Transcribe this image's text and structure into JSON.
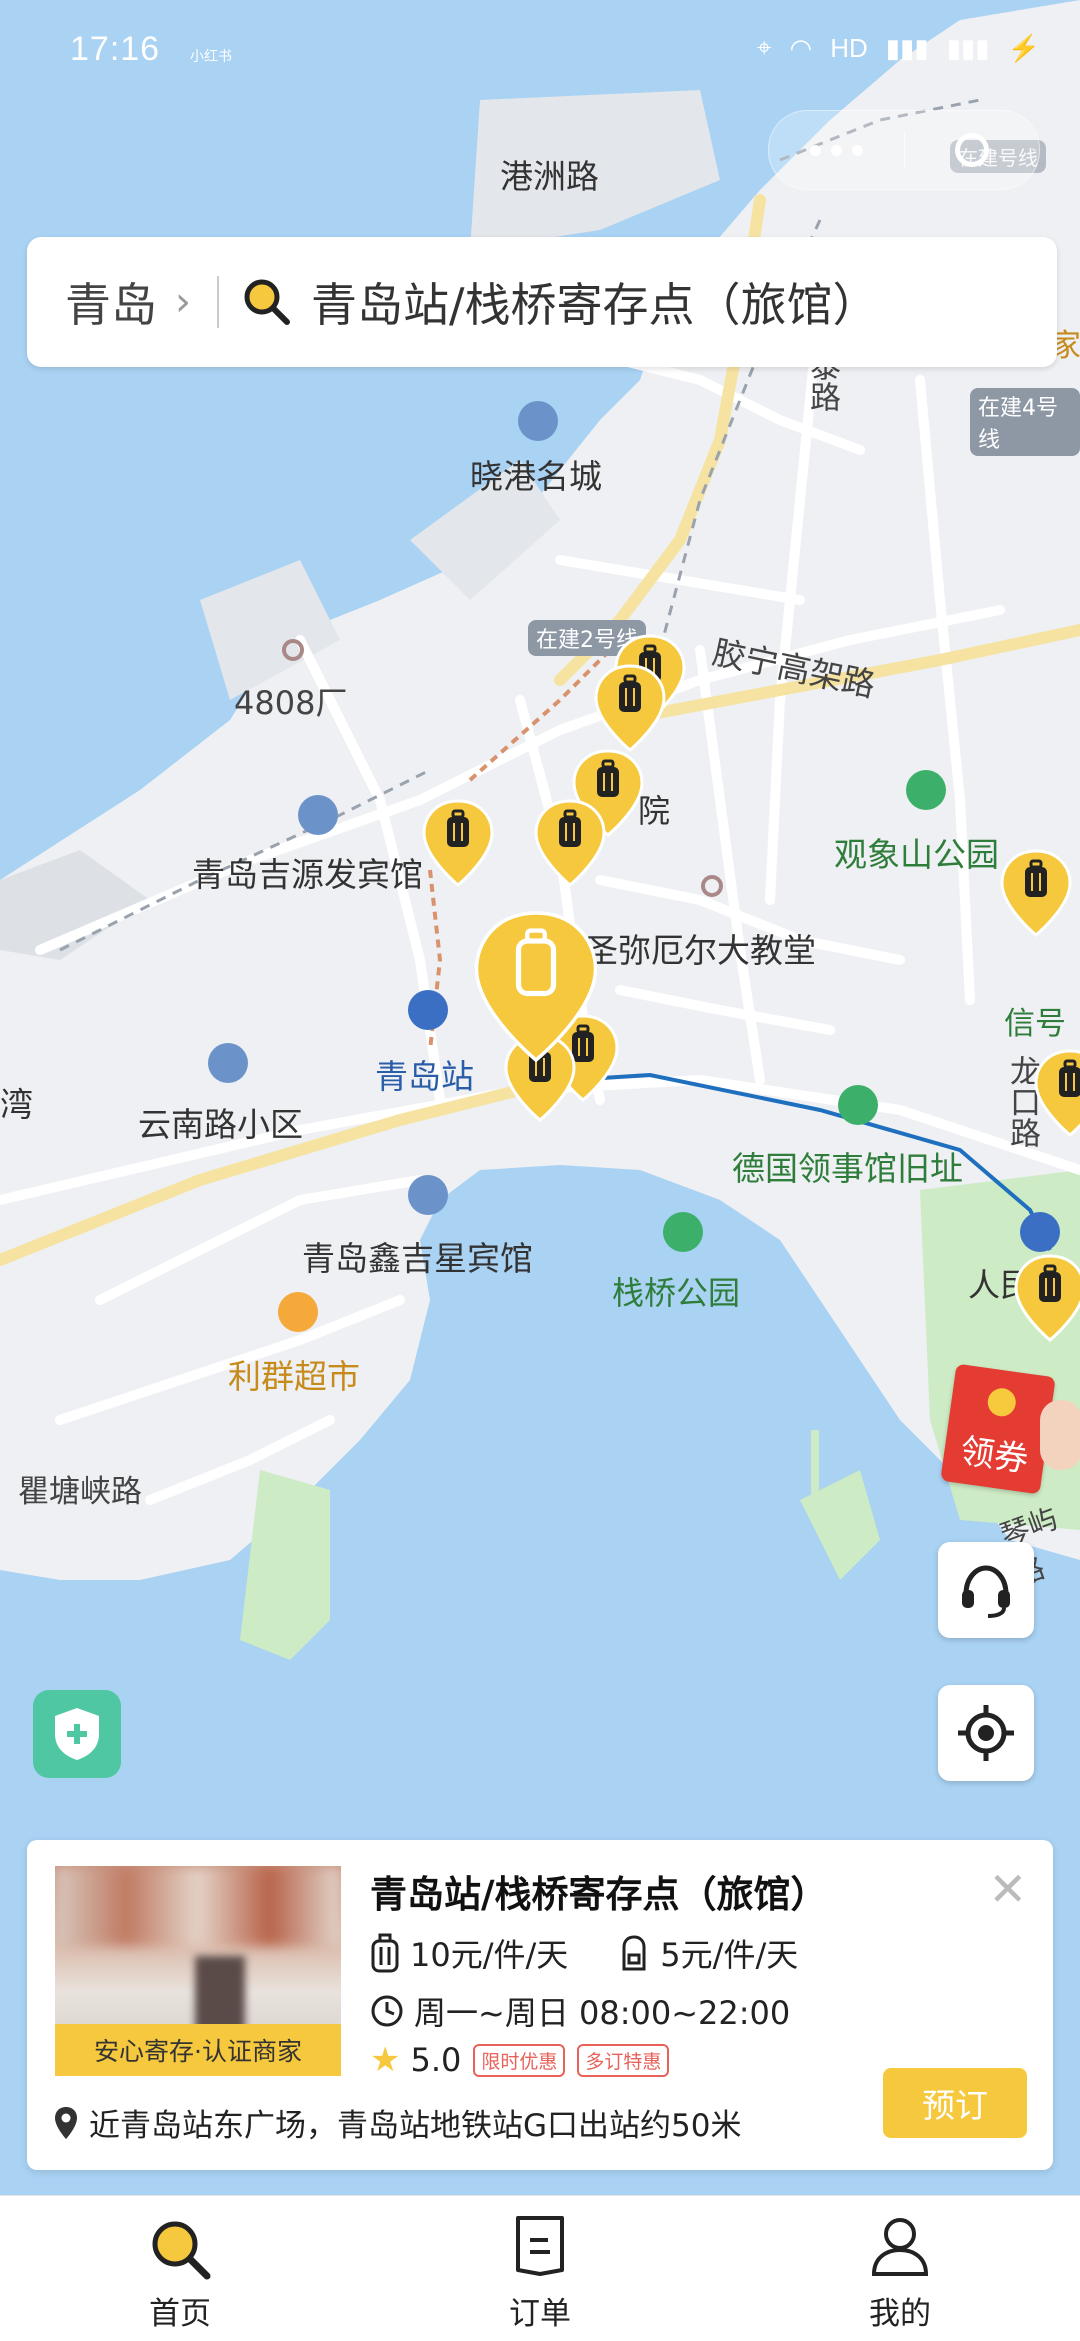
{
  "status_bar": {
    "time": "17:16",
    "small_label": "小红书",
    "network": "HD"
  },
  "search": {
    "city": "青岛",
    "query": "青岛站/栈桥寄存点（旅馆）"
  },
  "map": {
    "labels": {
      "gangzhou_road": "港洲路",
      "xiaogang": "晓港名城",
      "factory": "4808厂",
      "hotel_jiyuanfa": "青岛吉源发宾馆",
      "yunnan_road": "云南路小区",
      "qingdao_station": "青岛站",
      "hotel_xinjixing": "青岛鑫吉星宾馆",
      "liqun": "利群超市",
      "qutang_road": "瞿塘峡路",
      "zhanqiao": "栈桥公园",
      "consulate": "德国领事馆旧址",
      "cathedral": "圣弥厄尔大教堂",
      "guanxiang": "观象山公园",
      "jiaoning": "胶宁高架路",
      "metro2": "在建2号线",
      "metro4": "在建4号线",
      "metro_top": "在建号线",
      "hospital": "院",
      "xinhao": "信号",
      "longkou": "龙口路",
      "renmin": "人民",
      "qinyu": "琴屿路",
      "wan": "湾",
      "taiping_partial": "家",
      "qidong": "泰路"
    }
  },
  "coupon": {
    "label": "领券"
  },
  "card": {
    "title": "青岛站/栈桥寄存点（旅馆）",
    "badge": "安心寄存·认证商家",
    "price_large": "10元/件/天",
    "price_small": "5元/件/天",
    "hours": "周一~周日 08:00~22:00",
    "rating": "5.0",
    "tags": [
      "限时优惠",
      "多订特惠"
    ],
    "address": "近青岛站东广场，青岛站地铁站G口出站约50米",
    "book_button": "预订"
  },
  "tabs": [
    {
      "label": "首页"
    },
    {
      "label": "订单"
    },
    {
      "label": "我的"
    }
  ],
  "colors": {
    "accent": "#f6c83d",
    "water": "#a9d2f3",
    "park": "#cdebc4",
    "route": "#1f6fbf"
  }
}
